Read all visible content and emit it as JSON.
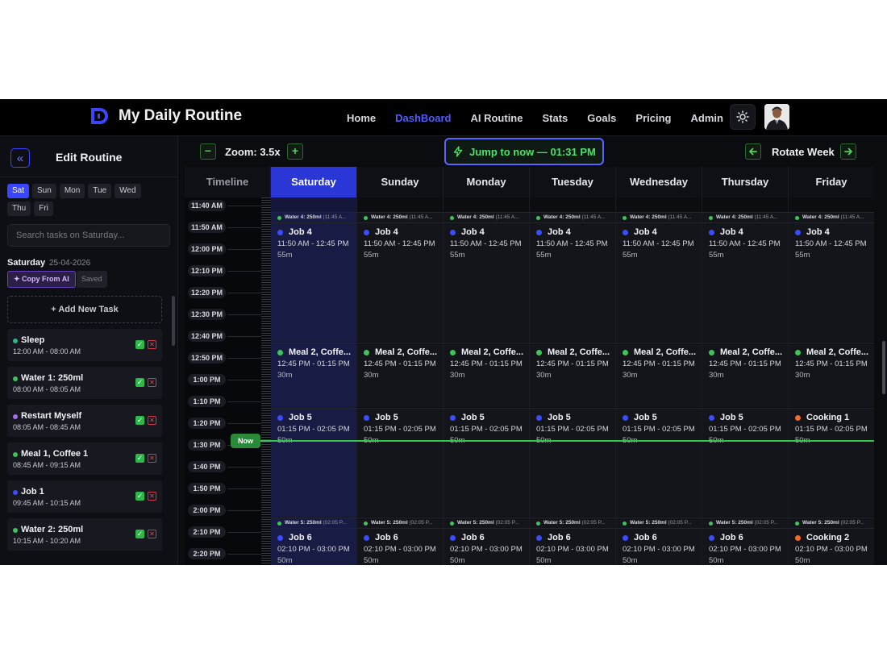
{
  "app": {
    "title": "My Daily Routine"
  },
  "nav": [
    {
      "label": "Home",
      "active": false
    },
    {
      "label": "DashBoard",
      "active": true
    },
    {
      "label": "AI Routine",
      "active": false
    },
    {
      "label": "Stats",
      "active": false
    },
    {
      "label": "Goals",
      "active": false
    },
    {
      "label": "Pricing",
      "active": false
    },
    {
      "label": "Admin",
      "active": false
    }
  ],
  "icons": {
    "theme": "sun-icon",
    "collapse": "double-chevron-left-icon",
    "jump": "lightning-icon",
    "prev": "arrow-left-icon",
    "next": "arrow-right-icon"
  },
  "colors": {
    "accent": "#3a45ff",
    "green": "#36c548",
    "blue_dot": "#3b4cff",
    "green_dot": "#3ec45a",
    "purple_dot": "#a86cf0",
    "teal_dot": "#2fb58a",
    "orange_dot": "#f06a2a"
  },
  "sidebar": {
    "title": "Edit Routine",
    "days": [
      "Sat",
      "Sun",
      "Mon",
      "Tue",
      "Wed",
      "Thu",
      "Fri"
    ],
    "active_day": "Sat",
    "search_placeholder": "Search tasks on Saturday...",
    "day_heading": "Saturday",
    "day_date": "25-04-2026",
    "copy_ai": "✦ Copy From AI",
    "saved": "Saved",
    "add_task": "+ Add New Task",
    "tasks": [
      {
        "name": "Sleep",
        "time": "12:00 AM - 08:00 AM",
        "color": "#2fb58a"
      },
      {
        "name": "Water 1: 250ml",
        "time": "08:00 AM - 08:05 AM",
        "color": "#3ec45a"
      },
      {
        "name": "Restart Myself",
        "time": "08:05 AM - 08:45 AM",
        "color": "#a86cf0"
      },
      {
        "name": "Meal 1, Coffee 1",
        "time": "08:45 AM - 09:15 AM",
        "color": "#3ec45a"
      },
      {
        "name": "Job 1",
        "time": "09:45 AM - 10:15 AM",
        "color": "#3b4cff"
      },
      {
        "name": "Water 2: 250ml",
        "time": "10:15 AM - 10:20 AM",
        "color": "#3ec45a"
      }
    ]
  },
  "toolbar": {
    "zoom_minus": "−",
    "zoom_label": "Zoom: 3.5x",
    "zoom_plus": "+",
    "jump": "Jump to now — 01:31 PM",
    "rotate": "Rotate Week"
  },
  "schedule": {
    "timeline_header": "Timeline",
    "days": [
      "Saturday",
      "Sunday",
      "Monday",
      "Tuesday",
      "Wednesday",
      "Thursday",
      "Friday"
    ],
    "active_day": "Saturday",
    "times": [
      "11:40 AM",
      "11:50 AM",
      "12:00 PM",
      "12:10 PM",
      "12:20 PM",
      "12:30 PM",
      "12:40 PM",
      "12:50 PM",
      "1:00 PM",
      "1:10 PM",
      "1:20 PM",
      "1:30 PM",
      "1:40 PM",
      "1:50 PM",
      "2:00 PM",
      "2:10 PM",
      "2:20 PM"
    ],
    "now_label": "Now",
    "mini_1": {
      "name": "Water 4: 250ml",
      "time": "(11:45 A..."
    },
    "mini_2": {
      "name": "Water 5: 250ml",
      "time": "(02:05 P..."
    },
    "job4": {
      "name": "Job 4",
      "time": "11:50 AM - 12:45 PM",
      "dur": "55m"
    },
    "meal2": {
      "name": "Meal 2, Coffe...",
      "time": "12:45 PM - 01:15 PM",
      "dur": "30m"
    },
    "job5": {
      "name": "Job 5",
      "time": "01:15 PM - 02:05 PM",
      "dur": "50m"
    },
    "cooking1": {
      "name": "Cooking 1",
      "time": "01:15 PM - 02:05 PM",
      "dur": "50m"
    },
    "job6": {
      "name": "Job 6",
      "time": "02:10 PM - 03:00 PM",
      "dur": "50m"
    },
    "cooking2": {
      "name": "Cooking 2",
      "time": "02:10 PM - 03:00 PM",
      "dur": "50m"
    }
  }
}
